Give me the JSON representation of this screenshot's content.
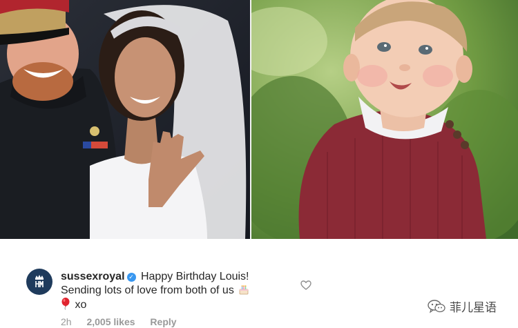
{
  "comment": {
    "username": "sussexroyal",
    "line1": "Happy Birthday Louis!",
    "line2": "Sending lots of love from both of us",
    "line3": "xo",
    "emoji_icons": [
      "birthday-cake-icon",
      "red-balloon-icon"
    ],
    "verified_icon": "verified-badge-icon",
    "like_icon": "heart-outline-icon"
  },
  "meta": {
    "time": "2h",
    "likes": "2,005 likes",
    "reply": "Reply"
  },
  "watermark": {
    "text": "菲儿星语",
    "icon": "wechat-icon"
  },
  "colors": {
    "verified": "#3897f0",
    "avatar_bg": "#1f3b5c",
    "meta_text": "#999999",
    "sweater": "#8b2a36"
  }
}
